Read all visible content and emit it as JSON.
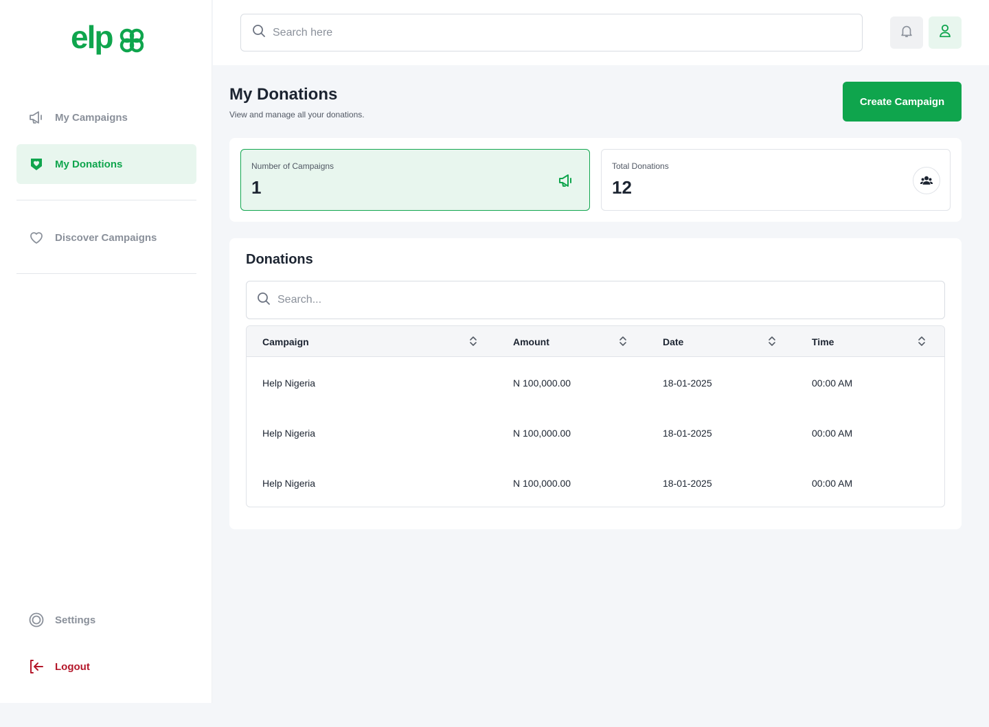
{
  "brand": {
    "logo_text": "elp",
    "accent": "#0fa54d",
    "danger": "#b4172a"
  },
  "sidebar": {
    "items": [
      {
        "label": "My Campaigns",
        "icon": "megaphone-icon"
      },
      {
        "label": "My Donations",
        "icon": "heart-hand-icon",
        "active": true
      },
      {
        "label": "Discover Campaigns",
        "icon": "heart-icon"
      },
      {
        "label": "Settings",
        "icon": "gear-icon"
      },
      {
        "label": "Logout",
        "icon": "logout-icon"
      }
    ]
  },
  "topbar": {
    "search_placeholder": "Search here",
    "notification_icon": "bell-icon",
    "profile_icon": "user-icon"
  },
  "page": {
    "title": "My Donations",
    "subtitle": "View and manage all your donations.",
    "create_button": "Create Campaign"
  },
  "stats": [
    {
      "label": "Number of Campaigns",
      "value": "1",
      "icon": "megaphone-icon"
    },
    {
      "label": "Total Donations",
      "value": "12",
      "icon": "users-icon"
    }
  ],
  "donations": {
    "title": "Donations",
    "search_placeholder": "Search...",
    "columns": [
      "Campaign",
      "Amount",
      "Date",
      "Time"
    ],
    "rows": [
      [
        "Help Nigeria",
        "N 100,000.00",
        "18-01-2025",
        "00:00 AM"
      ],
      [
        "Help Nigeria",
        "N 100,000.00",
        "18-01-2025",
        "00:00 AM"
      ],
      [
        "Help Nigeria",
        "N 100,000.00",
        "18-01-2025",
        "00:00 AM"
      ]
    ]
  }
}
